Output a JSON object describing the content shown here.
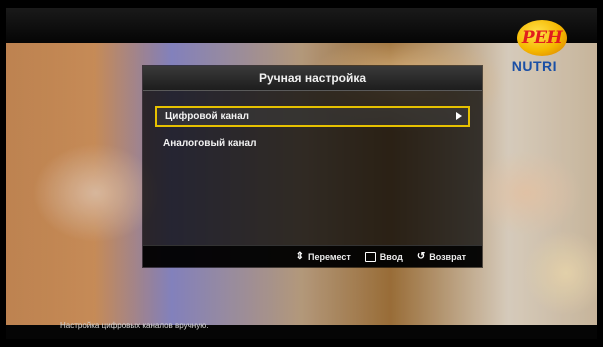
{
  "channel_logo": {
    "text": "РЕН"
  },
  "sponsor_logo": {
    "text": "NUTRI"
  },
  "menu": {
    "title": "Ручная настройка",
    "items": [
      {
        "label": "Цифровой канал",
        "selected": true,
        "has_submenu": true
      },
      {
        "label": "Аналоговый канал",
        "selected": false,
        "has_submenu": false
      }
    ],
    "footer": {
      "move_label": "Перемест",
      "enter_label": "Ввод",
      "return_label": "Возврат"
    }
  },
  "status": {
    "help_text": "Настройка цифровых каналов вручную."
  },
  "colors": {
    "highlight": "#e6c100",
    "menu_bg": "#0c0c0c",
    "logo_yellow": "#f5b800",
    "logo_red": "#e11d1d"
  },
  "icons": {
    "move": "up-down-arrow-icon",
    "enter": "enter-icon",
    "return": "return-icon",
    "submenu": "chevron-right-icon"
  }
}
